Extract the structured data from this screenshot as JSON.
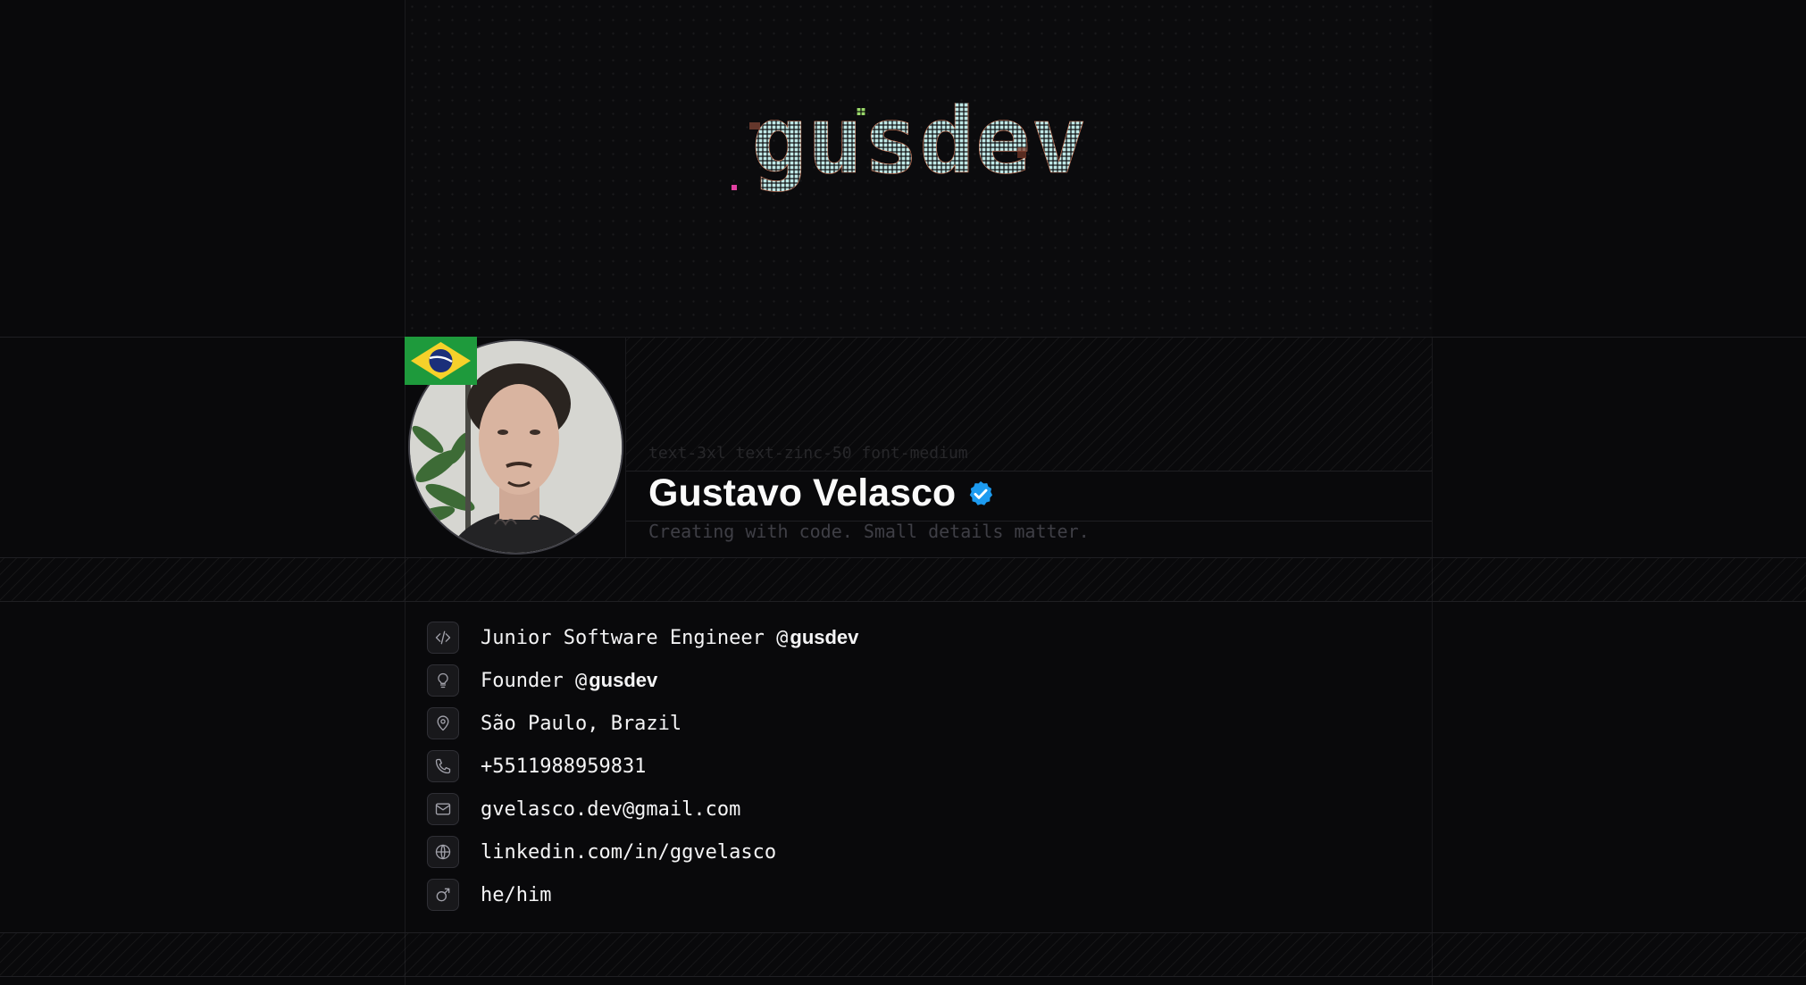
{
  "banner": {
    "logo_text": "gusdev"
  },
  "profile": {
    "class_hint": "text-3xl text-zinc-50 font-medium",
    "name": "Gustavo Velasco",
    "tagline": "Creating with code. Small details matter.",
    "flag_icon": "brazil-flag-icon",
    "verified_icon": "verified-badge-icon",
    "accent_color": "#1d9bf0"
  },
  "info": {
    "job": {
      "text": "Junior Software Engineer @",
      "link": "gusdev",
      "icon": "code-icon"
    },
    "founder": {
      "text": "Founder @",
      "link": "gusdev",
      "icon": "lightbulb-icon"
    },
    "location": {
      "text": "São Paulo, Brazil",
      "icon": "map-pin-icon"
    },
    "phone": {
      "text": "+5511988959831",
      "icon": "phone-icon"
    },
    "email": {
      "text": "gvelasco.dev@gmail.com",
      "icon": "mail-icon"
    },
    "website": {
      "text": "linkedin.com/in/ggvelasco",
      "icon": "globe-icon"
    },
    "pronouns": {
      "text": "he/him",
      "icon": "mars-icon"
    }
  }
}
